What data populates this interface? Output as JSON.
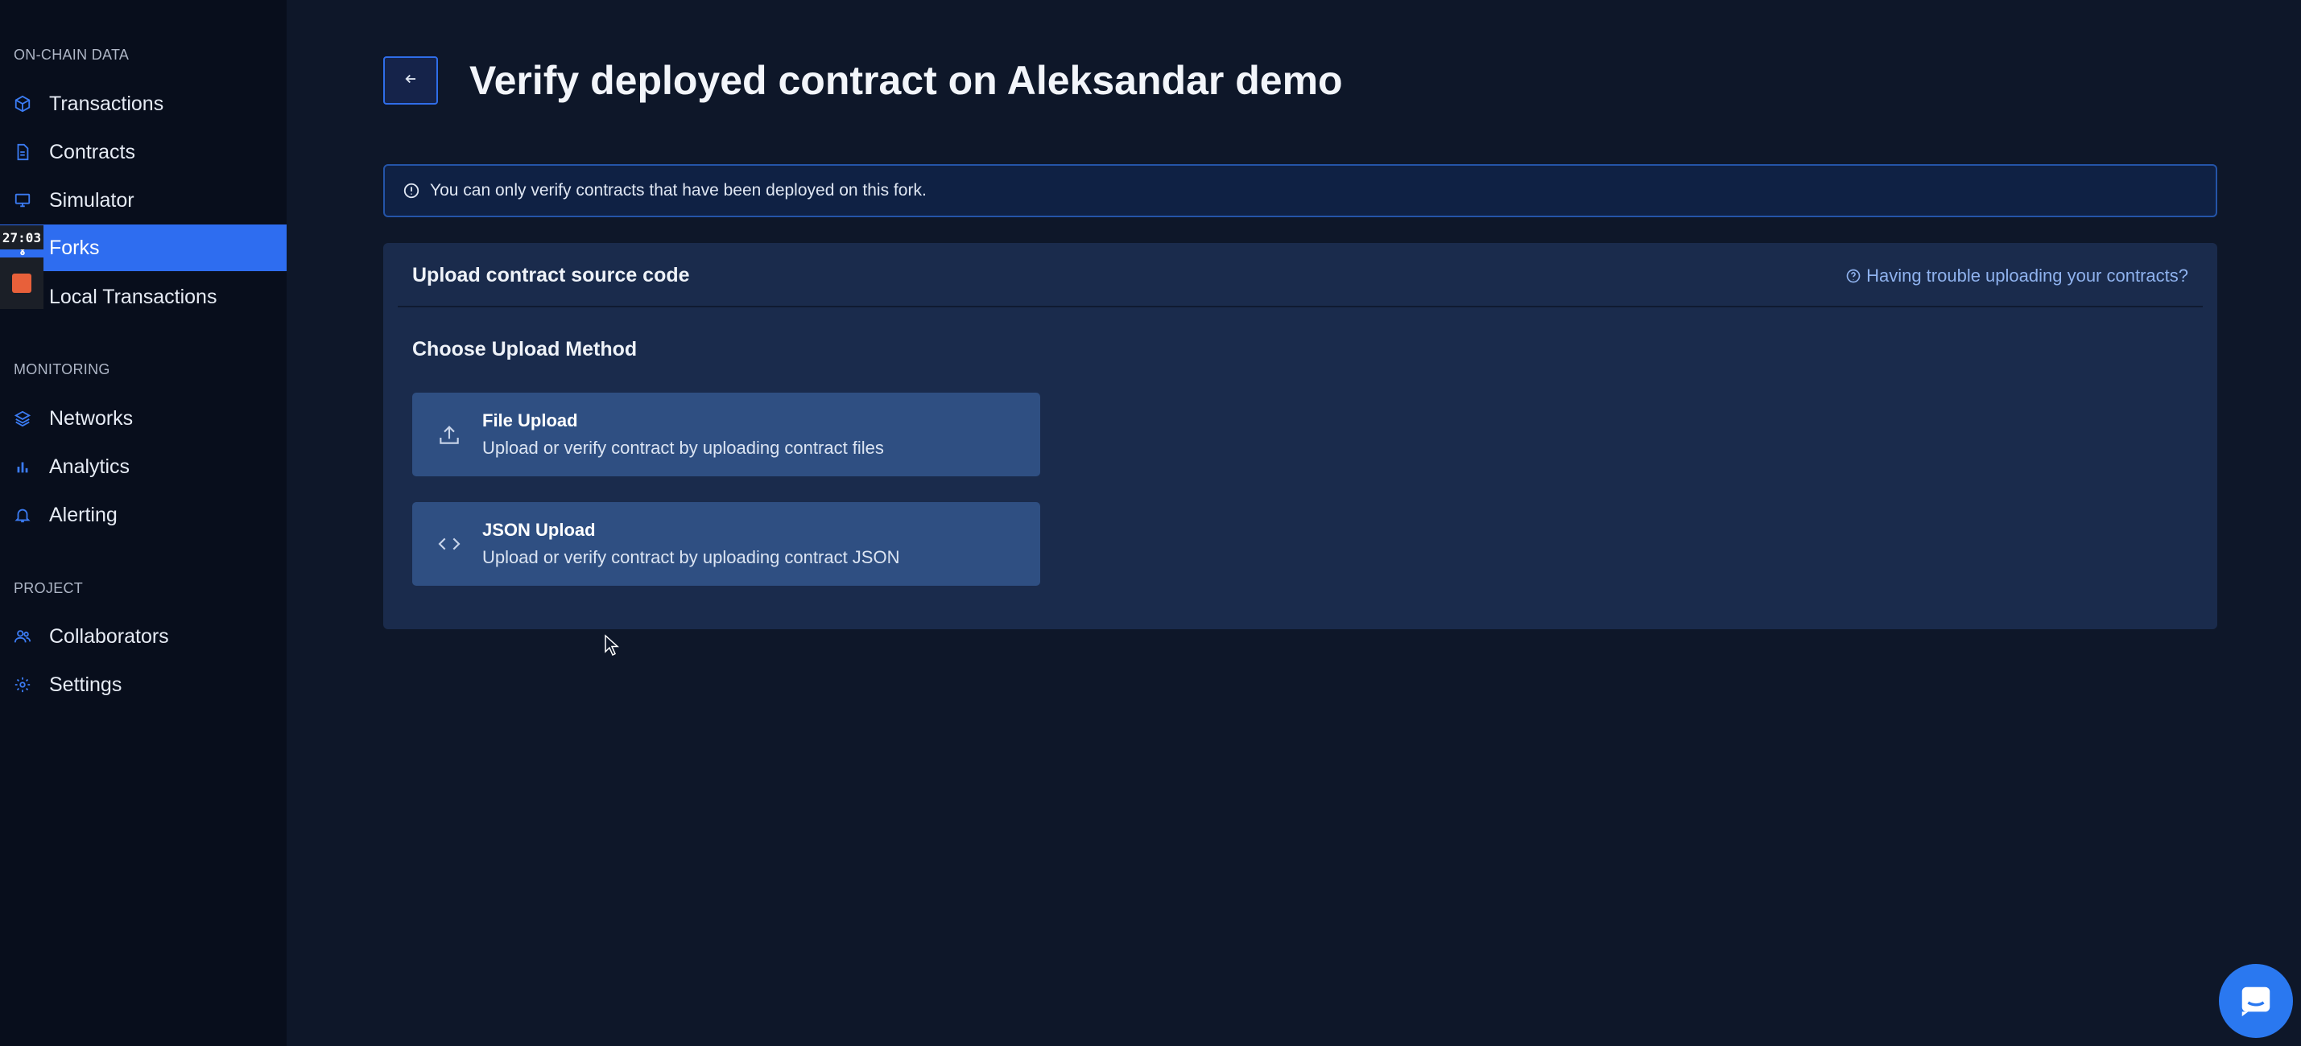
{
  "sidebar": {
    "sections": [
      {
        "title": "ON-CHAIN DATA"
      },
      {
        "title": "MONITORING"
      },
      {
        "title": "PROJECT"
      }
    ],
    "items": [
      {
        "label": "Transactions",
        "icon": "cube-icon"
      },
      {
        "label": "Contracts",
        "icon": "document-icon"
      },
      {
        "label": "Simulator",
        "icon": "monitor-icon"
      },
      {
        "label": "Forks",
        "icon": "fork-icon",
        "active": true
      },
      {
        "label": "Local Transactions",
        "icon": "local-icon"
      },
      {
        "label": "Networks",
        "icon": "layers-icon"
      },
      {
        "label": "Analytics",
        "icon": "bar-chart-icon"
      },
      {
        "label": "Alerting",
        "icon": "bell-icon"
      },
      {
        "label": "Collaborators",
        "icon": "users-icon"
      },
      {
        "label": "Settings",
        "icon": "gear-icon"
      }
    ]
  },
  "overlay": {
    "timer": "27:03"
  },
  "header": {
    "title": "Verify deployed contract on Aleksandar demo"
  },
  "banner": {
    "text": "You can only verify contracts that have been deployed on this fork."
  },
  "panel": {
    "title": "Upload contract source code",
    "help_link": "Having trouble uploading your contracts?",
    "choose_title": "Choose Upload Method",
    "methods": [
      {
        "title": "File Upload",
        "description": "Upload or verify contract by uploading contract files",
        "icon": "upload-icon"
      },
      {
        "title": "JSON Upload",
        "description": "Upload or verify contract by uploading contract JSON",
        "icon": "code-icon"
      }
    ]
  },
  "colors": {
    "background": "#0e1729",
    "sidebar": "#080e1c",
    "accent": "#2e6df0",
    "panel": "#1a2b4c",
    "card": "#2f4f82",
    "link": "#8fb2ee",
    "icon": "#3b7bf2"
  }
}
